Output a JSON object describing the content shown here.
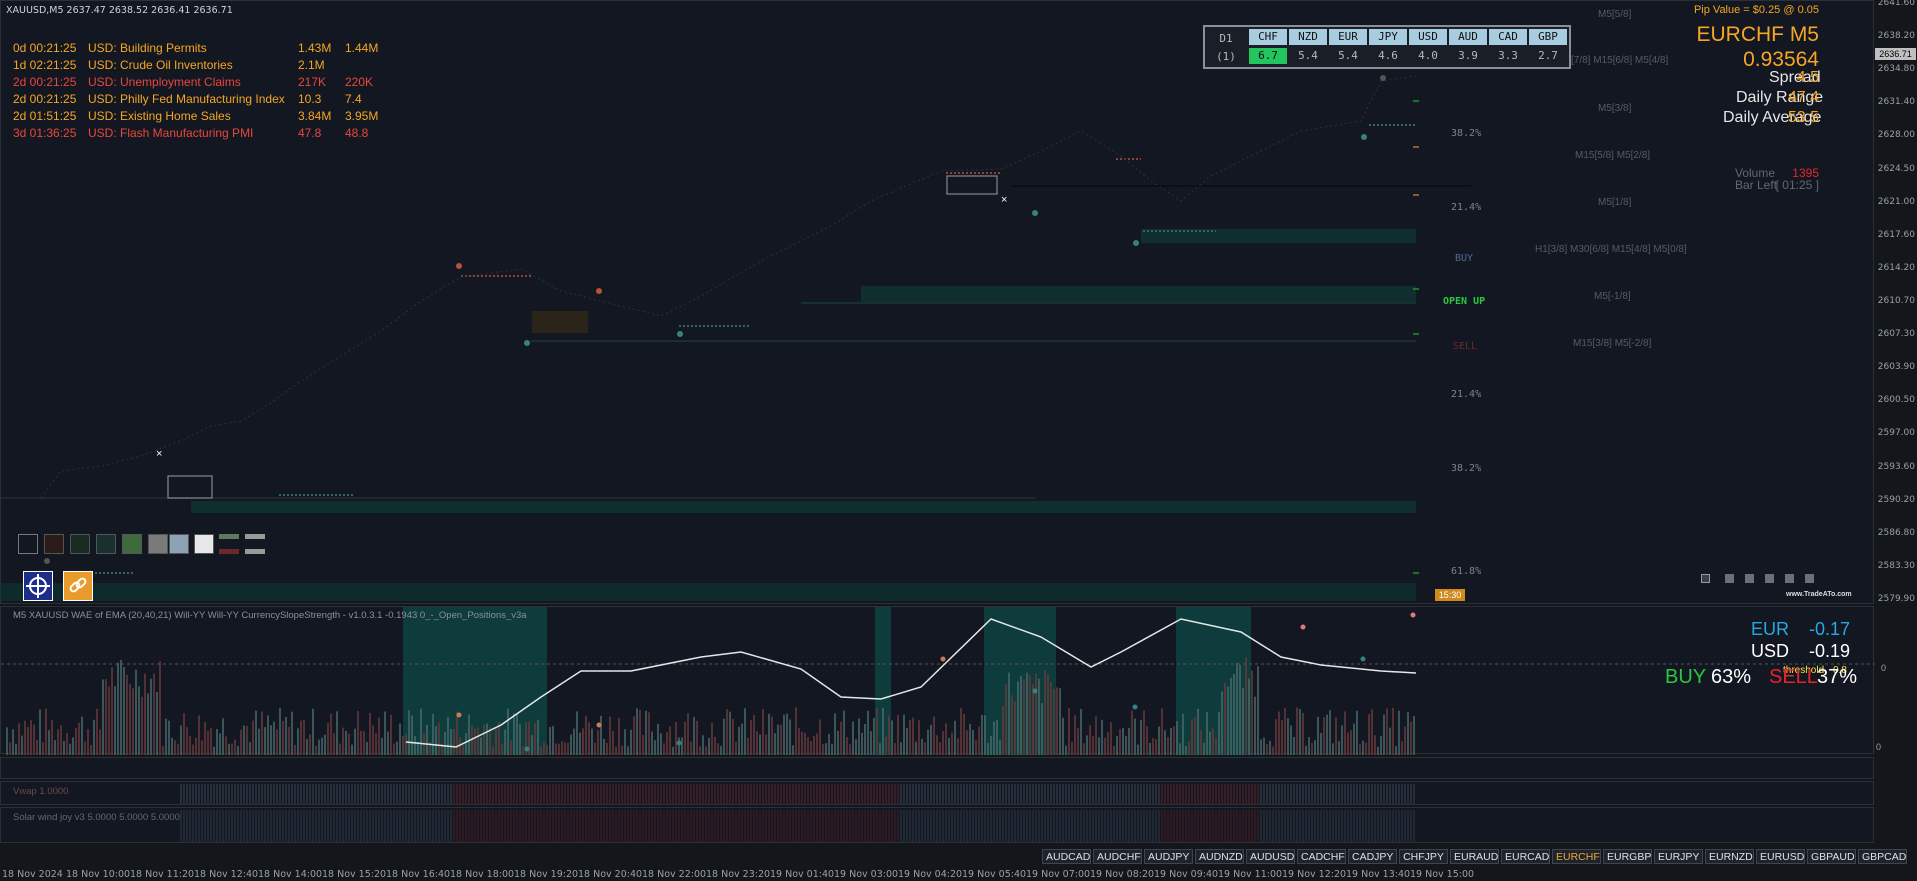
{
  "header": {
    "symbol_info": "XAUUSD,M5  2637.47 2638.52 2636.41 2636.71"
  },
  "news": [
    {
      "time": "0d 00:21:25",
      "event": "USD: Building Permits",
      "forecast": "1.43M",
      "previous": "1.44M",
      "color": "#f5a623"
    },
    {
      "time": "1d 02:21:25",
      "event": "USD: Crude Oil Inventories",
      "forecast": "2.1M",
      "previous": "",
      "color": "#f5a623"
    },
    {
      "time": "2d 00:21:25",
      "event": "USD: Unemployment Claims",
      "forecast": "217K",
      "previous": "220K",
      "color": "#e8473c"
    },
    {
      "time": "2d 00:21:25",
      "event": "USD: Philly Fed Manufacturing Index",
      "forecast": "10.3",
      "previous": "7.4",
      "color": "#f5a623"
    },
    {
      "time": "2d 01:51:25",
      "event": "USD: Existing Home Sales",
      "forecast": "3.84M",
      "previous": "3.95M",
      "color": "#f5a623"
    },
    {
      "time": "3d 01:36:25",
      "event": "USD: Flash Manufacturing PMI",
      "forecast": "47.8",
      "previous": "48.8",
      "color": "#e8473c"
    }
  ],
  "strength_table": {
    "timeframe": "D1",
    "row_label": "(1)",
    "currencies": [
      "CHF",
      "NZD",
      "EUR",
      "JPY",
      "USD",
      "AUD",
      "CAD",
      "GBP"
    ],
    "values": [
      "6.7",
      "5.4",
      "5.4",
      "4.6",
      "4.0",
      "3.9",
      "3.3",
      "2.7"
    ],
    "highlight_color": "#22c55e"
  },
  "info_panel": {
    "pip_value": "Pip Value = $0.25 @ 0.05",
    "pair_title": "EURCHF M5",
    "price": "0.93564",
    "spread_label": "Spread",
    "spread_value": "4.5",
    "daily_range_label": "Daily Range",
    "daily_range_value": "47.4",
    "daily_average_label": "Daily Average",
    "daily_average_value": "53.5",
    "volume_label": "Volume",
    "volume_value": "1395",
    "bar_left_label": "Bar Left",
    "bar_left_value": "[ 01:25 ]",
    "brand": "www.TradeATo.com"
  },
  "price_axis": {
    "ticks": [
      "2641.60",
      "2638.20",
      "2634.80",
      "2631.40",
      "2628.00",
      "2624.50",
      "2621.00",
      "2617.60",
      "2614.20",
      "2610.70",
      "2607.30",
      "2603.90",
      "2600.50",
      "2597.00",
      "2593.60",
      "2590.20",
      "2586.80",
      "2583.30",
      "2579.90"
    ],
    "current_price": "2636.71"
  },
  "fib_levels": [
    "38.2%",
    "21.4%",
    "21.4%",
    "38.2%",
    "61.8%"
  ],
  "signals": {
    "buy": "BUY",
    "open_up": "OPEN UP",
    "sell": "SELL"
  },
  "murrey_labels": [
    "M5[5/8]",
    "[7/8] M15[6/8] M5[4/8]",
    "M5[3/8]",
    "M15[5/8] M5[2/8]",
    "M5[1/8]",
    "H1[3/8] M30[6/8] M15[4/8] M5[0/8]",
    "M5[-1/8]",
    "M15[3/8] M5[-2/8]"
  ],
  "time_marker": "15:30",
  "indicator": {
    "title": "M5 XAUUSD WAE of EMA (20,40,21)  Will-YY  Will-YY  CurrencySlopeStrength - v1.0.3.1 -0.1943  0_-_Open_Positions_v3a",
    "eur_label": "EUR",
    "eur_value": "-0.17",
    "usd_label": "USD",
    "usd_value": "-0.19",
    "threshold_label": "threshold",
    "threshold_value": "0.8",
    "buy_label": "BUY",
    "buy_pct": "63%",
    "sell_label": "SELL",
    "sell_pct": "37%",
    "axis_zero": "0",
    "eur_color": "#29a8e0",
    "buy_color": "#27c93f",
    "sell_color": "#e8242a"
  },
  "sub_panes": {
    "vwap": "Vwap 1.0000",
    "solar": "Solar wind joy v3 5.0000 5.0000 5.0000"
  },
  "pair_buttons": [
    "AUDCAD",
    "AUDCHF",
    "AUDJPY",
    "AUDNZD",
    "AUDUSD",
    "CADCHF",
    "CADJPY",
    "CHFJPY",
    "EURAUD",
    "EURCAD",
    "EURCHF",
    "EURGBP",
    "EURJPY",
    "EURNZD",
    "EURUSD",
    "GBPAUD",
    "GBPCAD"
  ],
  "active_pair": "EURCHF",
  "time_axis": [
    "18 Nov 2024",
    "18 Nov 10:00",
    "18 Nov 11:20",
    "18 Nov 12:40",
    "18 Nov 14:00",
    "18 Nov 15:20",
    "18 Nov 16:40",
    "18 Nov 18:00",
    "18 Nov 19:20",
    "18 Nov 20:40",
    "18 Nov 22:00",
    "18 Nov 23:20",
    "19 Nov 01:40",
    "19 Nov 03:00",
    "19 Nov 04:20",
    "19 Nov 05:40",
    "19 Nov 07:00",
    "19 Nov 08:20",
    "19 Nov 09:40",
    "19 Nov 11:00",
    "19 Nov 12:20",
    "19 Nov 13:40",
    "19 Nov 15:00"
  ],
  "colors": {
    "accent": "#f5a623",
    "teal_zone": "#0e3b3b",
    "background": "#131722"
  },
  "icons": [
    "crosshair-icon",
    "link-icon"
  ]
}
